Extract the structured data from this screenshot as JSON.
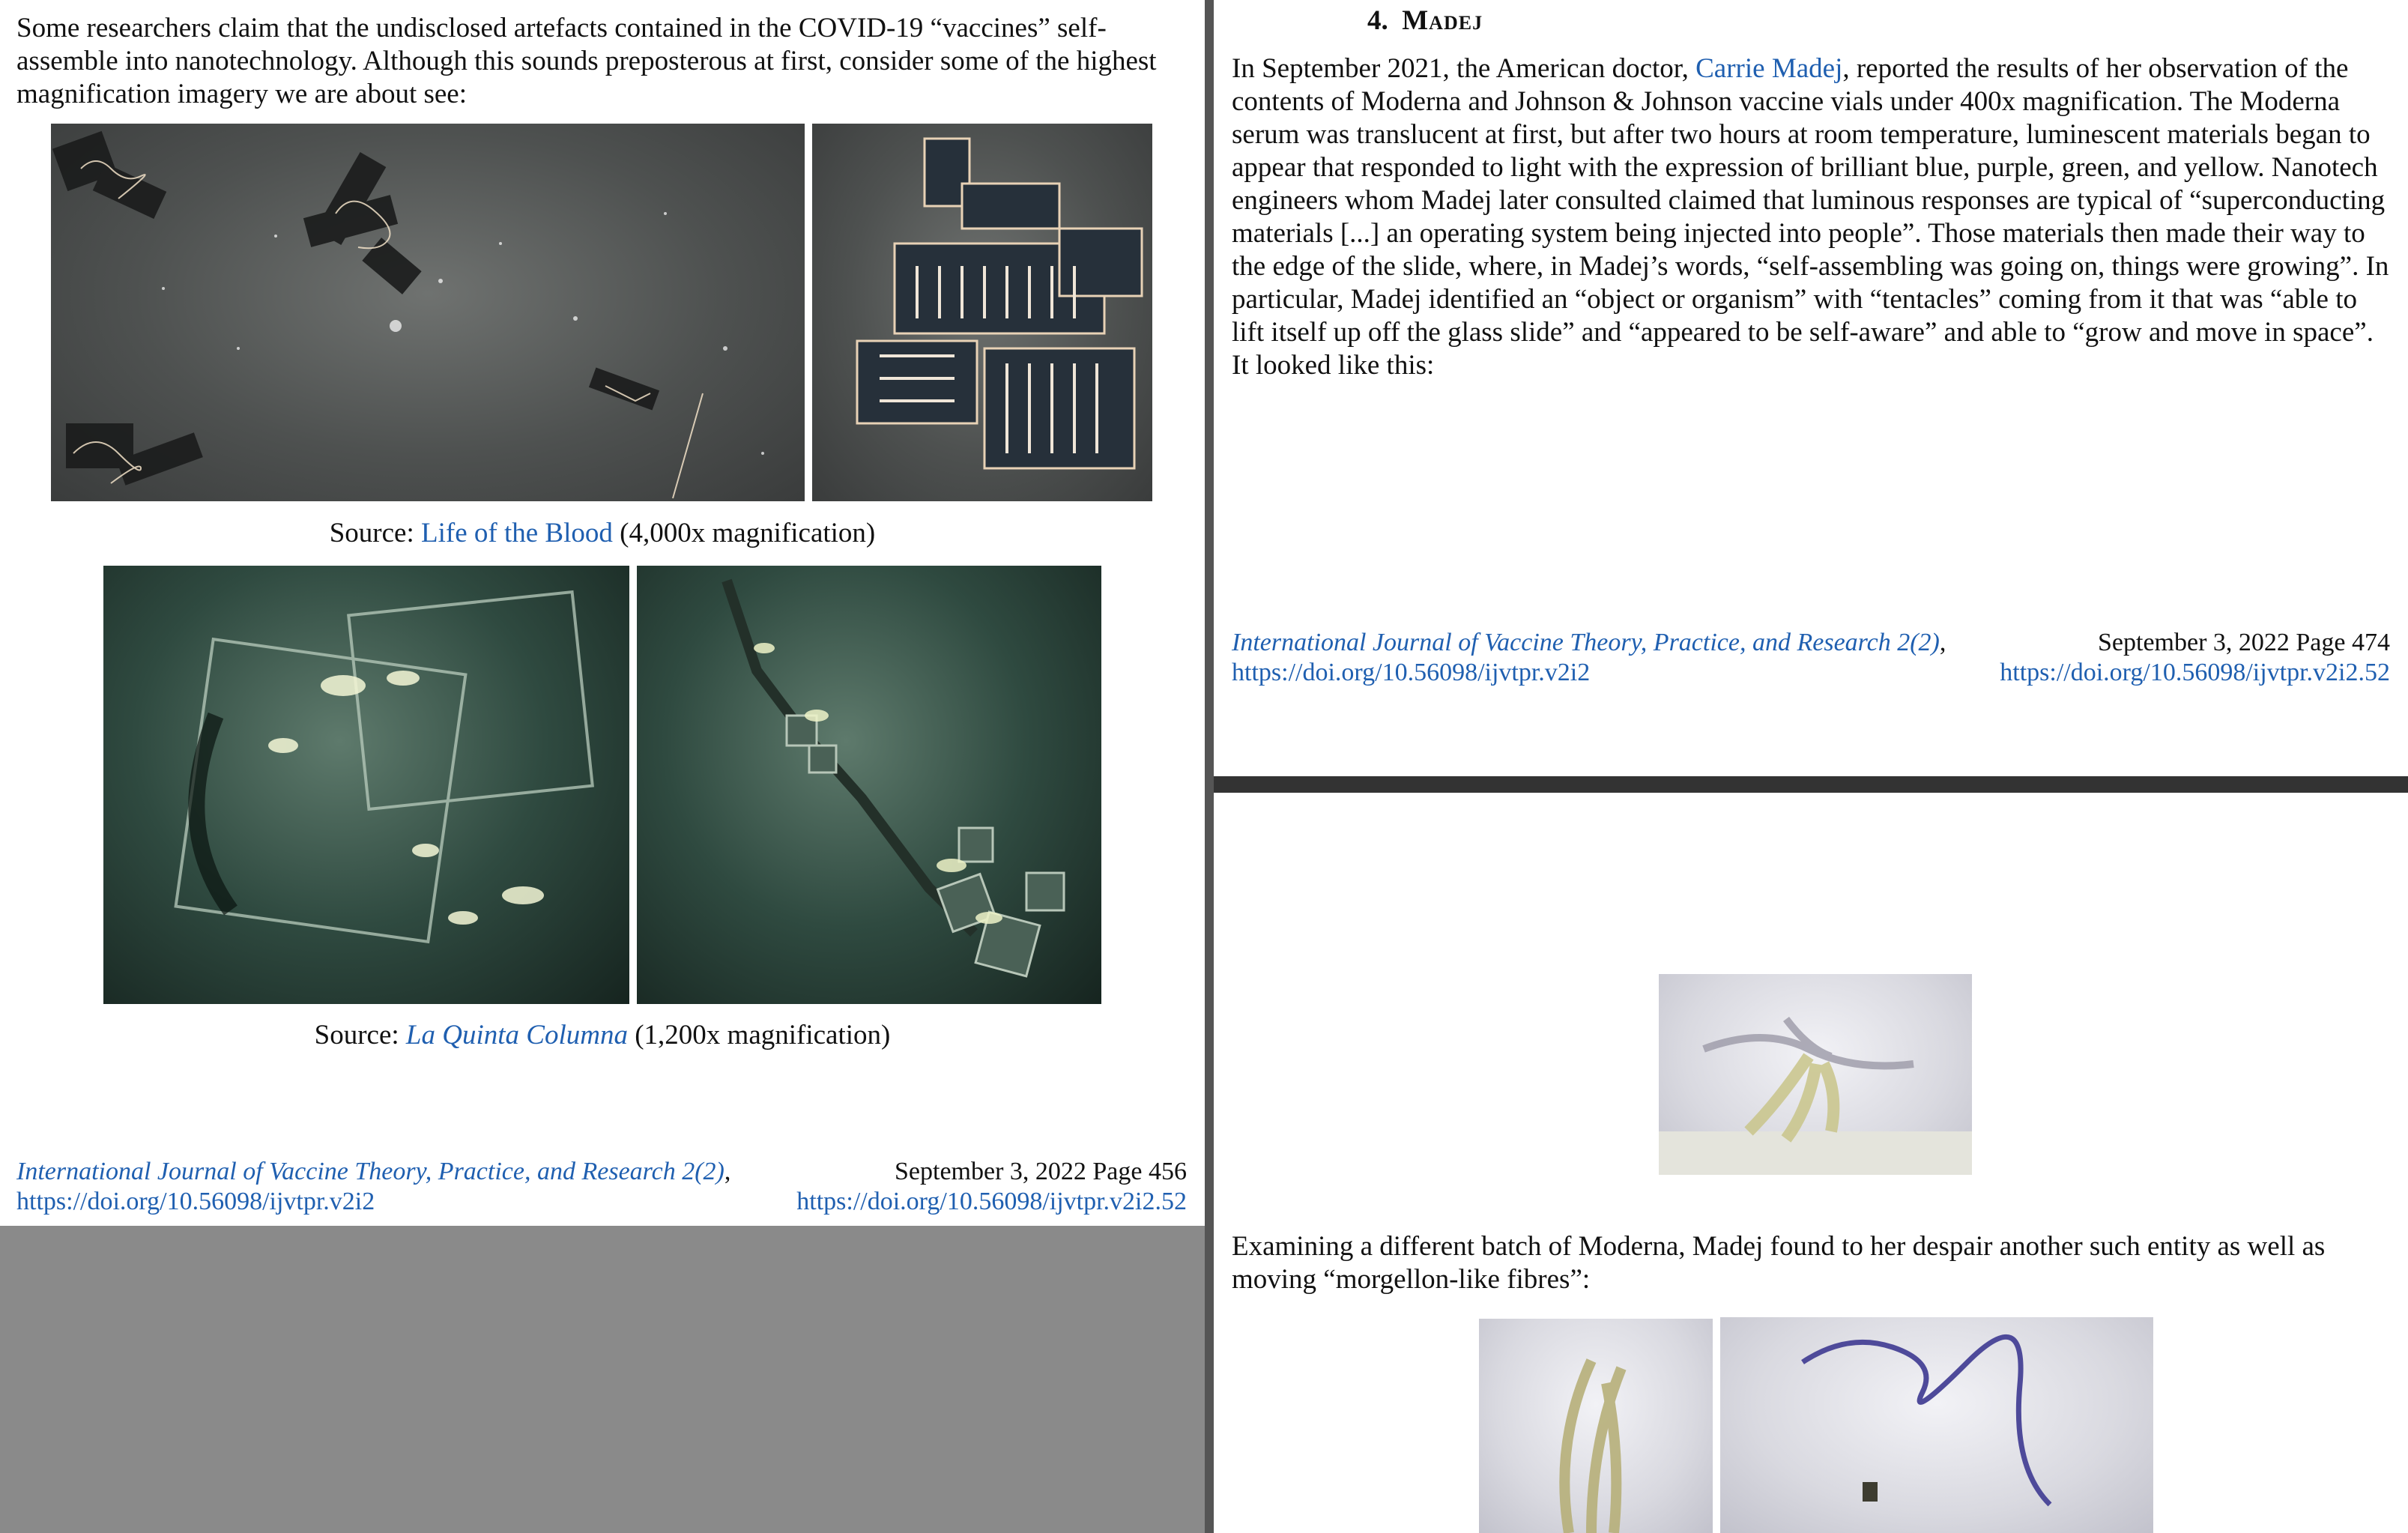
{
  "left_page": {
    "intro_text": "Some researchers claim that the undisclosed artefacts contained in the COVID-19 “vaccines” self-assemble into nanotechnology. Although this sounds preposterous at first, consider some of the highest magnification imagery we are about see:",
    "caption1_prefix": "Source: ",
    "caption1_link": "Life of the Blood",
    "caption1_suffix": " (4,000x magnification)",
    "caption2_prefix": "Source: ",
    "caption2_link": "La Quinta Columna",
    "caption2_suffix": " (1,200x magnification)",
    "footer_journal": "International Journal of Vaccine Theory, Practice, and Research 2(2)",
    "footer_comma": ",",
    "footer_doi_left": "https://doi.org/10.56098/ijvtpr.v2i2",
    "footer_date_page": "September 3, 2022  Page 456",
    "footer_doi_right": "https://doi.org/10.56098/ijvtpr.v2i2.52"
  },
  "right_top_page": {
    "heading_number": "4.",
    "heading_title": "Madej",
    "text_before_link": "In September 2021, the American doctor, ",
    "link": "Carrie Madej",
    "text_after_link": ", reported the results of her observation of the contents of Moderna and Johnson & Johnson vaccine vials under 400x magnification. The Moderna serum was translucent at first, but after two hours at room temperature, luminescent materials began to appear that responded to light with the expression of brilliant blue, purple, green, and yellow. Nanotech engineers whom Madej later consulted claimed that luminous responses are typical of “superconducting materials [...] an operating system being injected into people”. Those materials then made their way to the edge of the slide, where, in Madej’s words, “self-assembling was going on, things were growing”. In particular, Madej identified an “object or organism” with “tentacles” coming from it that was “able to lift itself up off the glass slide” and “appeared to be self-aware” and able to “grow and move in space”. It looked like this:",
    "footer_journal": "International Journal of Vaccine Theory, Practice, and Research 2(2)",
    "footer_comma": ",",
    "footer_doi_left": "https://doi.org/10.56098/ijvtpr.v2i2",
    "footer_date_page": "September 3, 2022  Page 474",
    "footer_doi_right": "https://doi.org/10.56098/ijvtpr.v2i2.52"
  },
  "right_bottom_page": {
    "text": "Examining a different batch of Moderna, Madej found to her despair another such entity as well as moving “morgellon-like fibres”:"
  }
}
